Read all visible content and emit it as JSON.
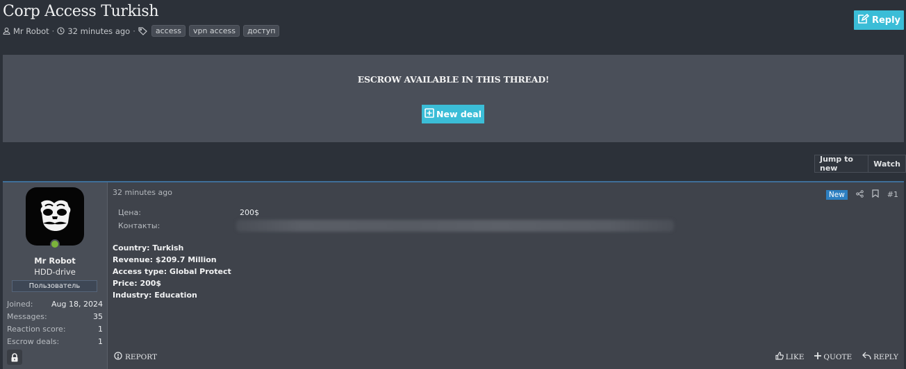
{
  "thread": {
    "title": "Corp Access Turkish",
    "author": "Mr Robot",
    "time": "32 minutes ago",
    "separator": "·",
    "tags": [
      "access",
      "vpn access",
      "доступ"
    ],
    "reply_label": "Reply"
  },
  "escrow": {
    "title": "ESCROW AVAILABLE IN THIS THREAD!",
    "new_deal_label": "New deal"
  },
  "thread_buttons": {
    "jump_label": "Jump to new",
    "watch_label": "Watch"
  },
  "post": {
    "user": {
      "name": "Mr Robot",
      "title": "HDD-drive",
      "banner": "Пользователь",
      "stats": [
        {
          "key": "Joined:",
          "value": "Aug 18, 2024"
        },
        {
          "key": "Messages:",
          "value": "35"
        },
        {
          "key": "Reaction score:",
          "value": "1"
        },
        {
          "key": "Escrow deals:",
          "value": "1"
        }
      ]
    },
    "date": "32 minutes ago",
    "new_badge": "New",
    "number": "#1",
    "fields": [
      {
        "key": "Цена:",
        "value": "200$"
      },
      {
        "key": "Контакты:",
        "value": ""
      }
    ],
    "lines": [
      "Country: Turkish",
      "Revenue: $209.7 Million",
      "Access type: Global Protect",
      "Price: 200$",
      "Industry: Education"
    ],
    "actions": {
      "report": "REPORT",
      "like": "LIKE",
      "quote": "QUOTE",
      "reply": "REPLY"
    }
  },
  "colors": {
    "accent": "#3bbdd7",
    "new_badge": "#2d7fc1",
    "online": "#7bb33b"
  }
}
